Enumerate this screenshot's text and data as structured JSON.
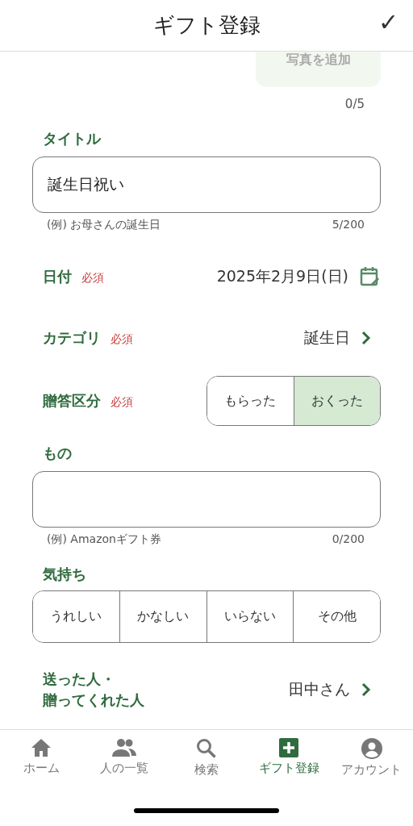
{
  "header": {
    "title": "ギフト登録",
    "confirm": "✓"
  },
  "photo": {
    "button": "写真を追加",
    "count": "0/5"
  },
  "title_field": {
    "label": "タイトル",
    "value": "誕生日祝い",
    "hint": "(例) お母さんの誕生日",
    "count": "5/200"
  },
  "date": {
    "label": "日付",
    "required": "必須",
    "value": "2025年2月9日(日)"
  },
  "category": {
    "label": "カテゴリ",
    "required": "必須",
    "value": "誕生日"
  },
  "direction": {
    "label": "贈答区分",
    "required": "必須",
    "options": [
      {
        "label": "もらった",
        "selected": false
      },
      {
        "label": "おくった",
        "selected": true
      }
    ]
  },
  "item_field": {
    "label": "もの",
    "hint": "(例) Amazonギフト券",
    "count": "0/200"
  },
  "feeling": {
    "label": "気持ち",
    "options": [
      {
        "label": "うれしい",
        "selected": false
      },
      {
        "label": "かなしい",
        "selected": false
      },
      {
        "label": "いらない",
        "selected": false
      },
      {
        "label": "その他",
        "selected": false
      }
    ]
  },
  "person": {
    "label_lines": [
      "送った人・",
      "贈ってくれた人"
    ],
    "value": "田中さん"
  },
  "tab_bar": [
    {
      "kind": "home",
      "label": "ホーム",
      "selected": false
    },
    {
      "kind": "people",
      "label": "人の一覧",
      "selected": false
    },
    {
      "kind": "search",
      "label": "検索",
      "selected": false
    },
    {
      "kind": "add",
      "label": "ギフト登録",
      "selected": true
    },
    {
      "kind": "account",
      "label": "アカウント",
      "selected": false
    }
  ]
}
